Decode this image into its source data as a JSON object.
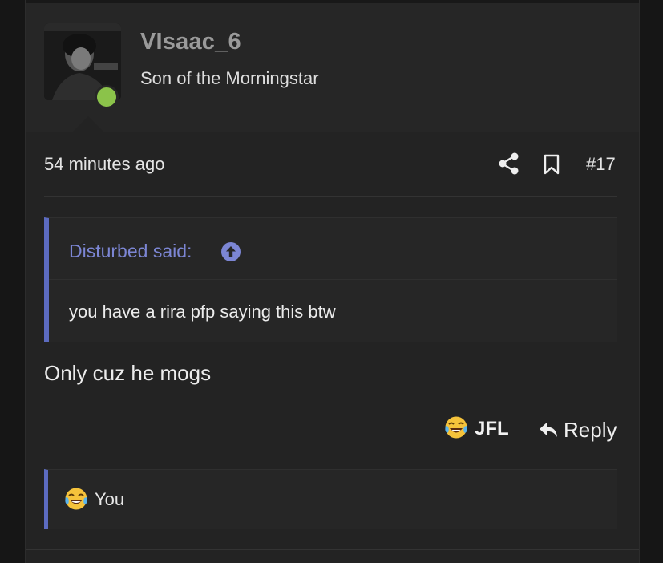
{
  "user": {
    "name": "VIsaac_6",
    "title": "Son of the Morningstar",
    "online_color": "#8bc34a"
  },
  "post": {
    "time": "54 minutes ago",
    "number": "#17",
    "body": "Only cuz he mogs"
  },
  "quote": {
    "author_said": "Disturbed said:",
    "text": "you have a rira pfp saying this btw"
  },
  "actions": {
    "reaction_label": "JFL",
    "reply_label": "Reply"
  },
  "reactions_summary": {
    "users": "You"
  },
  "colors": {
    "accent": "#5c6bc0",
    "quote_author": "#7c86d4",
    "background": "#232323"
  },
  "icons": {
    "share": "share-icon",
    "bookmark": "bookmark-icon",
    "quote_jump": "arrow-up-circle-icon",
    "reply": "reply-arrow-icon",
    "reaction": "crying-laughing-emoji-icon"
  }
}
